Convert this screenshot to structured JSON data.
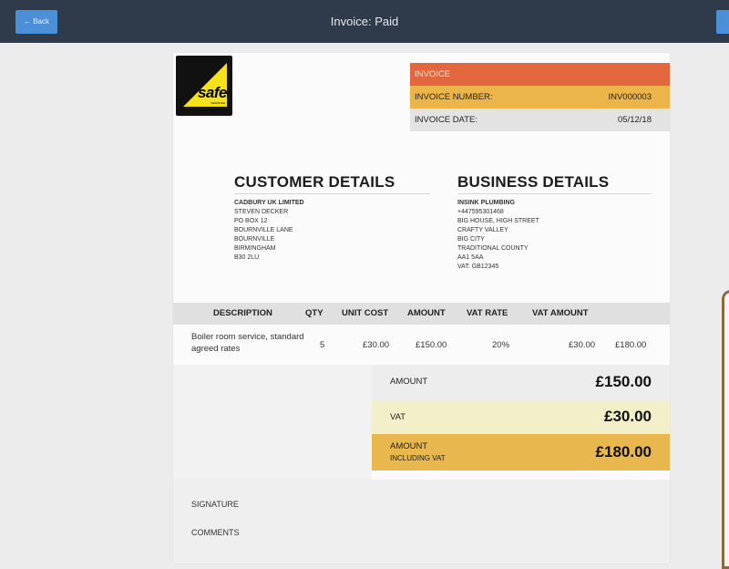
{
  "header": {
    "back_label": "← Back",
    "title": "Invoice: Paid"
  },
  "logo": {
    "text": "safe",
    "subtext": "REGISTER"
  },
  "invoice_info": {
    "heading": "INVOICE",
    "number_label": "INVOICE NUMBER:",
    "number_value": "INV000003",
    "date_label": "INVOICE DATE:",
    "date_value": "05/12/18"
  },
  "customer": {
    "title": "CUSTOMER DETAILS",
    "name": "CADBURY UK LIMITED",
    "lines": [
      "STEVEN DECKER",
      "PO BOX 12",
      "BOURNVILLE LANE",
      "BOURNVILLE",
      "BIRMINGHAM",
      "B30 2LU"
    ]
  },
  "business": {
    "title": "BUSINESS DETAILS",
    "name": "INSINK PLUMBING",
    "lines": [
      "+447595301468",
      "BIG HOUSE, HIGH STREET",
      "CRAFTY VALLEY",
      "BIG CITY",
      "TRADITIONAL COUNTY",
      "AA1 5AA",
      "VAT: GB12345"
    ]
  },
  "table": {
    "headers": {
      "description": "DESCRIPTION",
      "qty": "QTY",
      "unit_cost": "UNIT COST",
      "amount": "AMOUNT",
      "vat_rate": "VAT RATE",
      "vat_amount": "VAT AMOUNT"
    },
    "rows": [
      {
        "description": "Boiler room service, standard agreed rates",
        "qty": "5",
        "unit_cost": "£30.00",
        "amount": "£150.00",
        "vat_rate": "20%",
        "vat_amount": "£30.00",
        "total": "£180.00"
      }
    ]
  },
  "totals": {
    "amount_label": "AMOUNT",
    "amount_value": "£150.00",
    "vat_label": "VAT",
    "vat_value": "£30.00",
    "incl_label_1": "AMOUNT",
    "incl_label_2": "INCLUDING VAT",
    "incl_value": "£180.00"
  },
  "footer": {
    "signature_label": "SIGNATURE",
    "comments_label": "COMMENTS"
  },
  "colors": {
    "topbar": "#2f3a4b",
    "button": "#4a90d9",
    "invoice_heading": "#e2663e",
    "invoice_number": "#ecb549",
    "total_incl_vat": "#e8b74d"
  }
}
